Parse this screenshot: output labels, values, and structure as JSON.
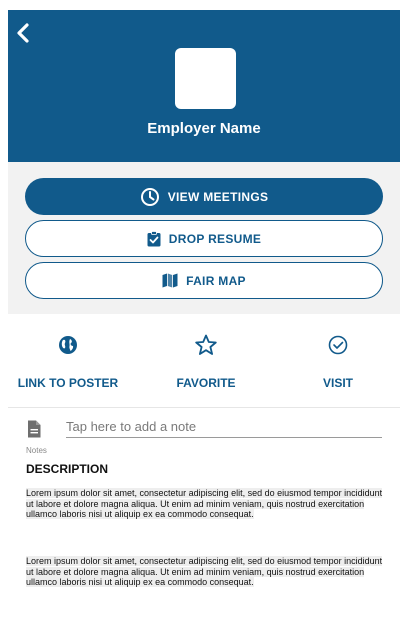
{
  "header": {
    "employer_name": "Employer Name"
  },
  "buttons": {
    "view_meetings": "VIEW MEETINGS",
    "drop_resume": "DROP RESUME",
    "fair_map": "FAIR MAP"
  },
  "actions": {
    "link_to_poster": "LINK TO POSTER",
    "favorite": "FAVORITE",
    "visit": "VISIT"
  },
  "notes": {
    "placeholder": "Tap here to add a note",
    "caption": "Notes"
  },
  "description": {
    "title": "DESCRIPTION",
    "paragraphs": [
      "Lorem ipsum dolor sit amet, consectetur adipiscing elit, sed do eiusmod tempor incididunt ut labore et dolore magna aliqua. Ut enim ad minim veniam, quis nostrud exercitation ullamco laboris nisi ut aliquip ex ea commodo consequat.",
      "Lorem ipsum dolor sit amet, consectetur adipiscing elit, sed do eiusmod tempor incididunt ut labore et dolore magna aliqua. Ut enim ad minim veniam, quis nostrud exercitation ullamco laboris nisi ut aliquip ex ea commodo consequat."
    ]
  },
  "icons": {
    "back": "chevron-left-icon",
    "view_meetings": "clock-icon",
    "drop_resume": "clipboard-check-icon",
    "fair_map": "map-icon",
    "link_to_poster": "globe-icon",
    "favorite": "star-outline-icon",
    "visit": "check-circle-icon",
    "notes": "document-icon"
  },
  "colors": {
    "primary": "#115a8b",
    "button_area_bg": "#f2f2f2",
    "text": "#111111"
  }
}
